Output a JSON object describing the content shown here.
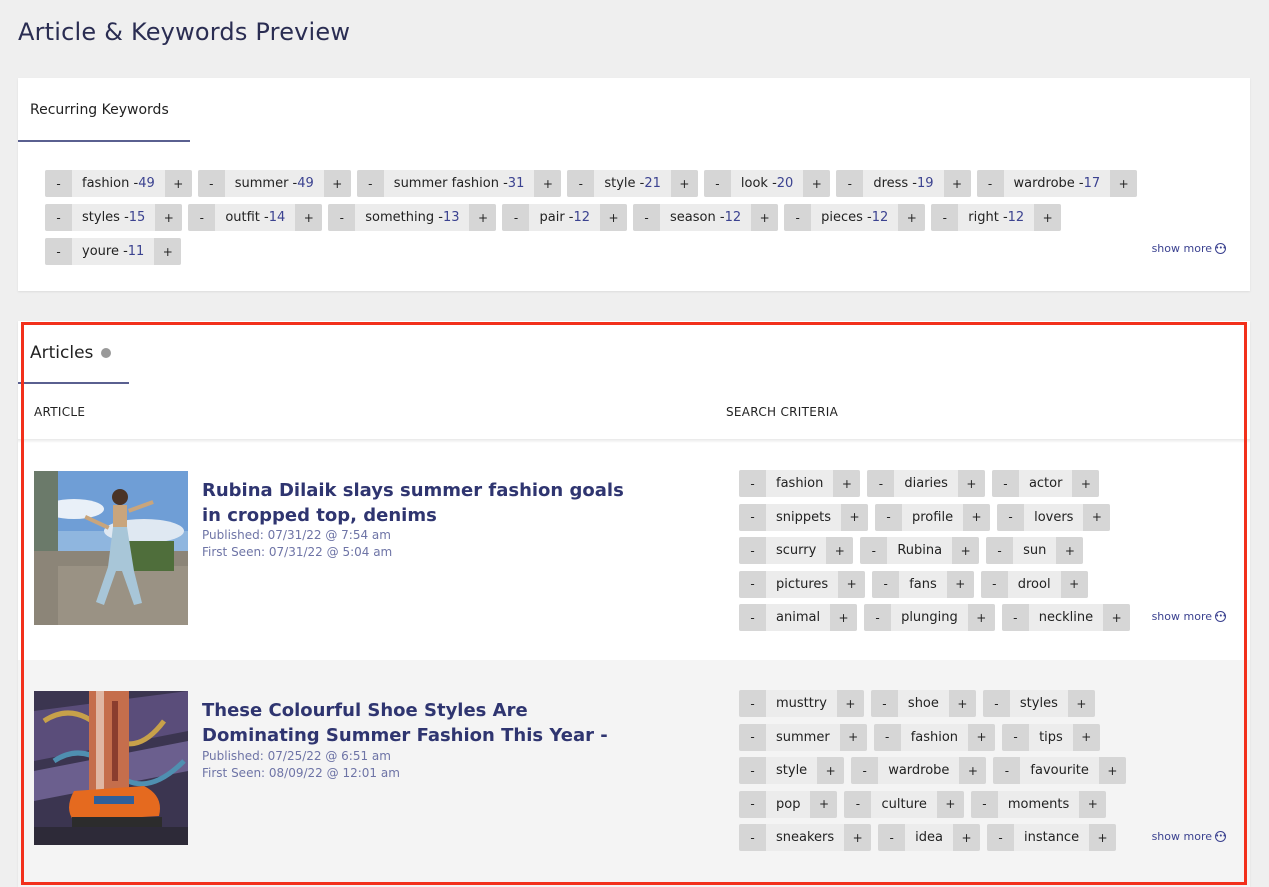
{
  "page_title": "Article & Keywords Preview",
  "keywords_section": {
    "tab_label": "Recurring Keywords",
    "show_more": "show more",
    "keywords": [
      {
        "word": "fashion",
        "count": "49"
      },
      {
        "word": "summer",
        "count": "49"
      },
      {
        "word": "summer fashion",
        "count": "31"
      },
      {
        "word": "style",
        "count": "21"
      },
      {
        "word": "look",
        "count": "20"
      },
      {
        "word": "dress",
        "count": "19"
      },
      {
        "word": "wardrobe",
        "count": "17"
      },
      {
        "word": "styles",
        "count": "15"
      },
      {
        "word": "outfit",
        "count": "14"
      },
      {
        "word": "something",
        "count": "13"
      },
      {
        "word": "pair",
        "count": "12"
      },
      {
        "word": "season",
        "count": "12"
      },
      {
        "word": "pieces",
        "count": "12"
      },
      {
        "word": "right",
        "count": "12"
      },
      {
        "word": "youre",
        "count": "11"
      }
    ]
  },
  "articles_section": {
    "tab_label": "Articles",
    "col_article": "ARTICLE",
    "col_criteria": "SEARCH CRITERIA",
    "show_more": "show more",
    "articles": [
      {
        "title": "Rubina Dilaik slays summer fashion goals in cropped top, denims",
        "published": "Published: 07/31/22 @ 7:54 am",
        "first_seen": "First Seen: 07/31/22 @ 5:04 am",
        "criteria": [
          "fashion",
          "diaries",
          "actor",
          "snippets",
          "profile",
          "lovers",
          "scurry",
          "Rubina",
          "sun",
          "pictures",
          "fans",
          "drool",
          "animal",
          "plunging",
          "neckline"
        ]
      },
      {
        "title": "These Colourful Shoe Styles Are Dominating Summer Fashion This Year -",
        "published": "Published: 07/25/22 @ 6:51 am",
        "first_seen": "First Seen: 08/09/22 @ 12:01 am",
        "criteria": [
          "musttry",
          "shoe",
          "styles",
          "summer",
          "fashion",
          "tips",
          "style",
          "wardrobe",
          "favourite",
          "pop",
          "culture",
          "moments",
          "sneakers",
          "idea",
          "instance"
        ]
      }
    ]
  },
  "chip_minus": "-",
  "chip_plus": "+",
  "kw_separator": " - ",
  "colors": {
    "accent": "#2f3570",
    "count": "#3b4290",
    "highlight": "#f2301b"
  }
}
